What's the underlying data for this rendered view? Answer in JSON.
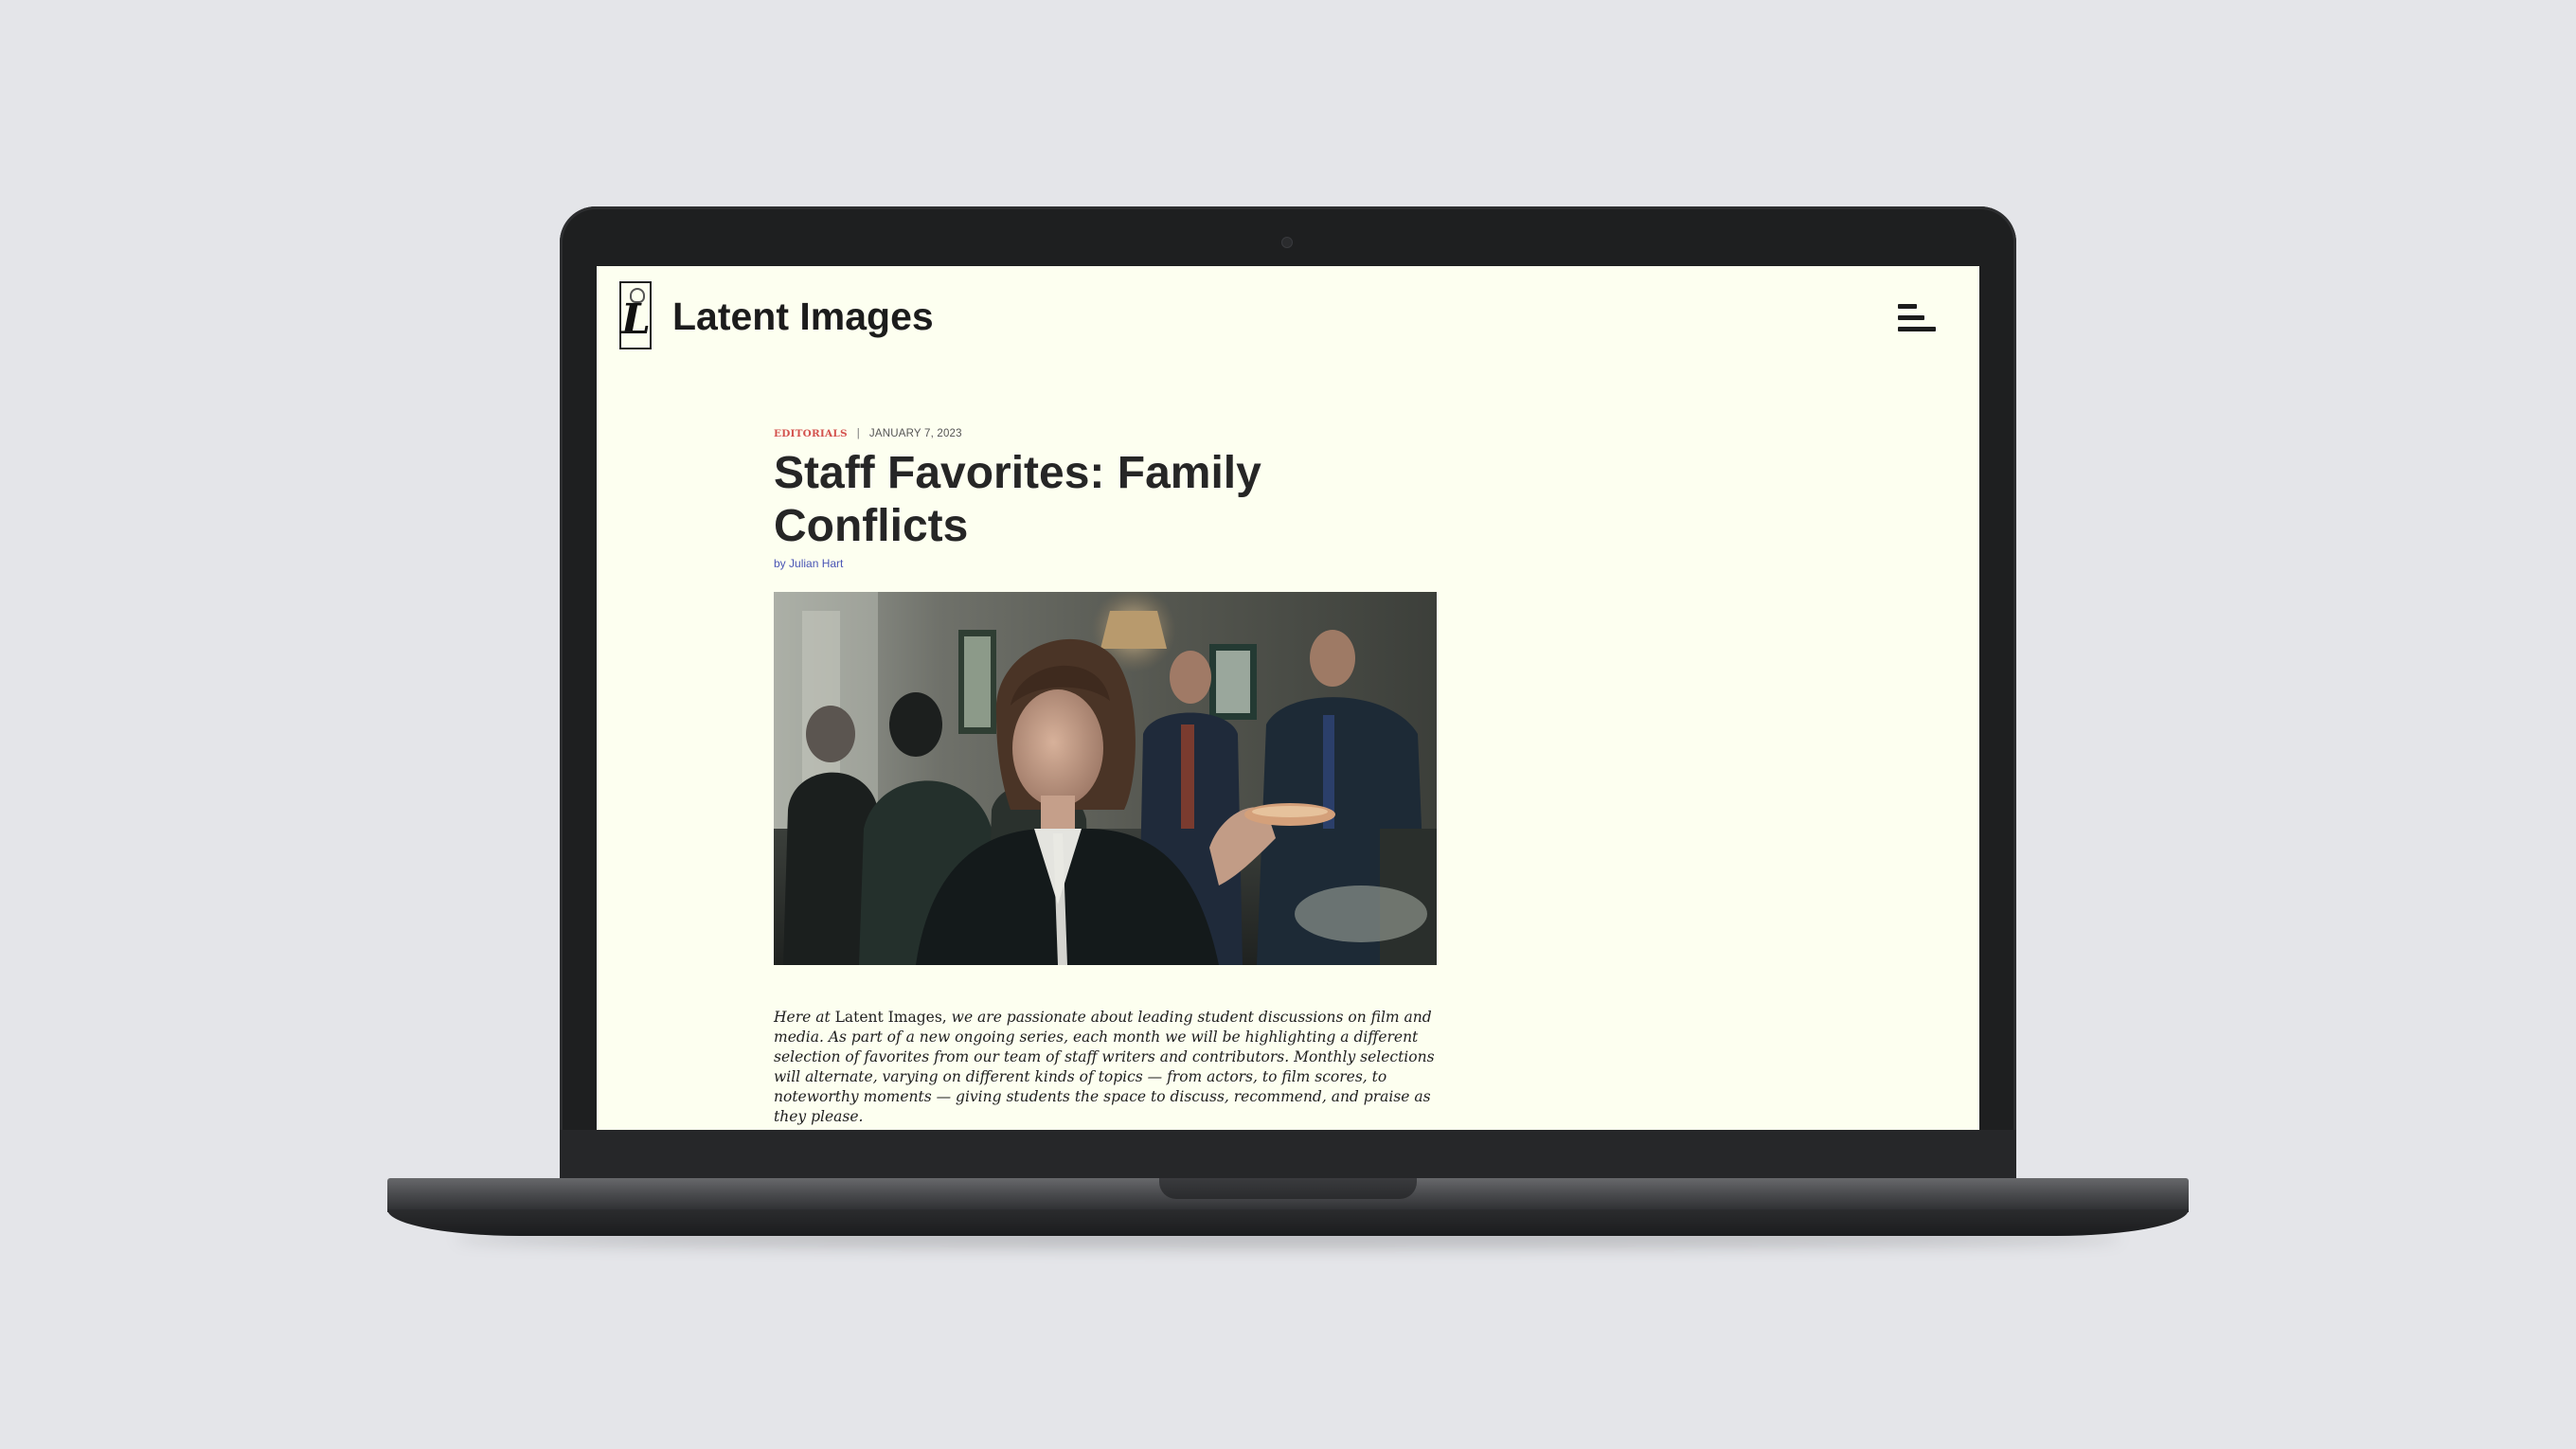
{
  "site": {
    "logo_letter": "L",
    "title": "Latent Images",
    "menu_icon": "hamburger-menu-icon"
  },
  "article": {
    "category": "EDITORIALS",
    "separator": "|",
    "date": "JANUARY 7, 2023",
    "title": "Staff Favorites: Family Conflicts",
    "byline_prefix": "by",
    "author": "Julian Hart",
    "hero_image": "film-still-family-gathering",
    "lede_intro": "Here at",
    "lede_publication": "Latent Images,",
    "lede_body": "we are passionate about leading student discussions on film and media. As part of a new ongoing series, each month we will be highlighting a different selection of favorites from our team of staff writers and contributors. Monthly selections will alternate, varying on different kinds of topics — from actors, to film scores, to noteworthy moments — giving students the space to discuss, recommend, and praise as they please."
  },
  "colors": {
    "page_background": "#fdfff0",
    "category_accent": "#d4534f",
    "link": "#4a55b5",
    "text": "#262626"
  }
}
